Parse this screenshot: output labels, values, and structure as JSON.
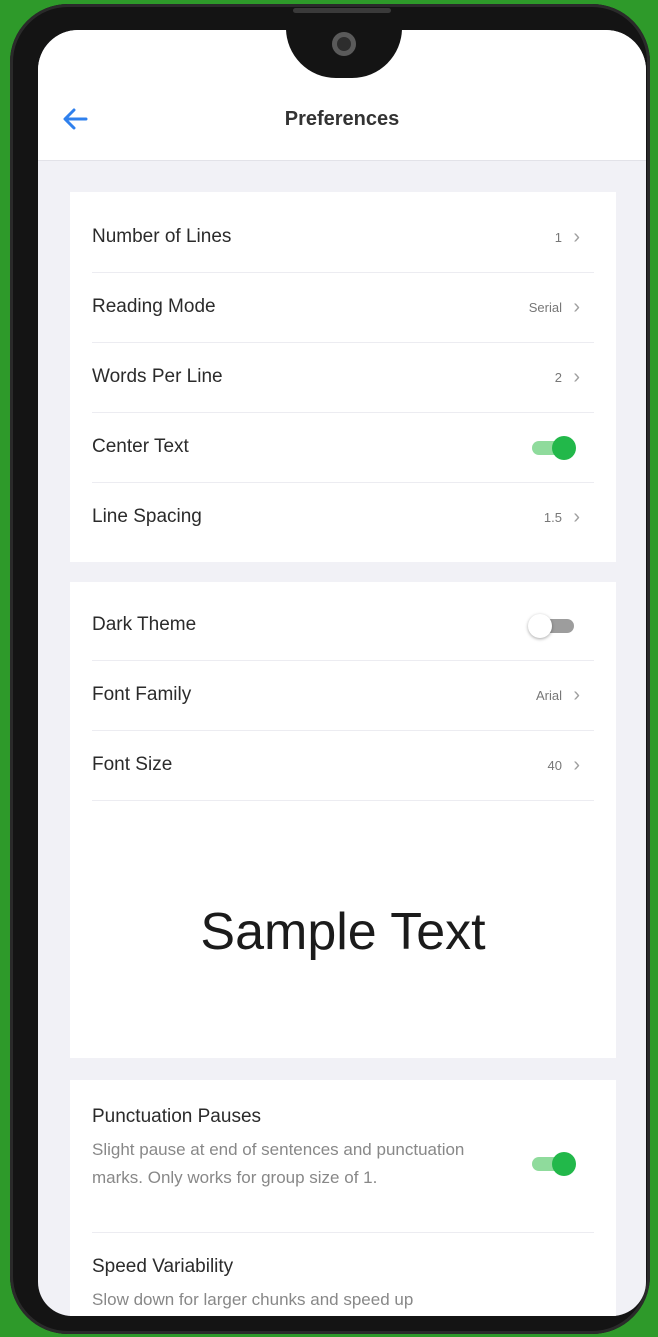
{
  "header": {
    "title": "Preferences"
  },
  "icons": {
    "back": "arrow-left-icon",
    "chevron": "chevron-right-icon"
  },
  "colors": {
    "accent_blue": "#2f80ed",
    "toggle_on": "#22b84a",
    "toggle_on_track": "#8fdb9c",
    "toggle_off_track": "#9d9d9d"
  },
  "reading": {
    "number_of_lines": {
      "label": "Number of Lines",
      "value": "1"
    },
    "reading_mode": {
      "label": "Reading Mode",
      "value": "Serial"
    },
    "words_per_line": {
      "label": "Words Per Line",
      "value": "2"
    },
    "center_text": {
      "label": "Center Text",
      "enabled": true
    },
    "line_spacing": {
      "label": "Line Spacing",
      "value": "1.5"
    }
  },
  "appearance": {
    "dark_theme": {
      "label": "Dark Theme",
      "enabled": false
    },
    "font_family": {
      "label": "Font Family",
      "value": "Arial"
    },
    "font_size": {
      "label": "Font Size",
      "value": "40"
    },
    "sample_text": "Sample Text"
  },
  "pacing": {
    "punctuation_pauses": {
      "label": "Punctuation Pauses",
      "description": "Slight pause at end of sentences and punctuation marks. Only works for group size of 1.",
      "enabled": true
    },
    "speed_variability": {
      "label": "Speed Variability",
      "description": "Slow down for larger chunks and speed up",
      "enabled": false
    }
  }
}
